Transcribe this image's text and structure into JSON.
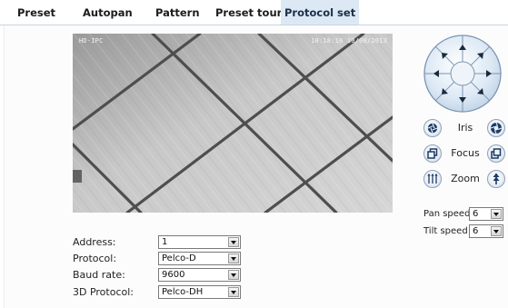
{
  "tabs": [
    {
      "label": "Preset",
      "active": false
    },
    {
      "label": "Autopan",
      "active": false
    },
    {
      "label": "Pattern",
      "active": false
    },
    {
      "label": "Preset tour",
      "active": false
    },
    {
      "label": "Protocol set",
      "active": true
    }
  ],
  "video": {
    "osd_title": "HD-IPC",
    "osd_timestamp": "10:18:10 10/08/2013"
  },
  "ptz": {
    "directions": [
      "up",
      "up-right",
      "right",
      "down-right",
      "down",
      "down-left",
      "left",
      "up-left"
    ],
    "icon": "ptz-direction-wheel-icon"
  },
  "lens": {
    "iris": {
      "label": "Iris",
      "minus_icon": "iris-close-icon",
      "plus_icon": "iris-open-icon"
    },
    "focus": {
      "label": "Focus",
      "minus_icon": "focus-near-icon",
      "plus_icon": "focus-far-icon"
    },
    "zoom": {
      "label": "Zoom",
      "minus_icon": "zoom-out-icon",
      "plus_icon": "zoom-in-icon"
    }
  },
  "speed": {
    "pan": {
      "label": "Pan speed",
      "value": "6"
    },
    "tilt": {
      "label": "Tilt speed",
      "value": "6"
    }
  },
  "form": {
    "address": {
      "label": "Address:",
      "value": "1"
    },
    "protocol": {
      "label": "Protocol:",
      "value": "Pelco-D"
    },
    "baud_rate": {
      "label": "Baud rate:",
      "value": "9600"
    },
    "protocol_3d": {
      "label": "3D Protocol:",
      "value": "Pelco-DH"
    }
  },
  "colors": {
    "active_tab_bg": "#dce9f5",
    "wheel_fill": "#cfe0f1",
    "wheel_stroke": "#7d95b1"
  }
}
